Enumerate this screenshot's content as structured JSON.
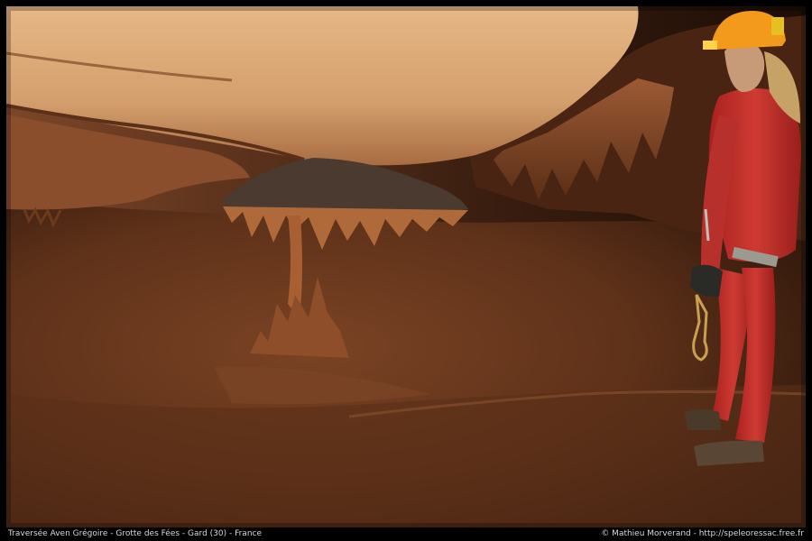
{
  "caption": {
    "left": "Traversée Aven Grégoire - Grotte des Fées - Gard (30) - France",
    "right": "© Mathieu Morverand - http://speleoressac.free.fr"
  },
  "colors": {
    "frame": "#000000",
    "caption_text": "#d8d8d8",
    "rock_ceiling": "#d9a676",
    "cave_floor": "#6b3a20",
    "mud": "#8a4a28",
    "caver_suit": "#c2302c",
    "helmet": "#f39a1c"
  },
  "scene": {
    "subjects": [
      "cave-ceiling",
      "stalactite-table",
      "stalagmite-column",
      "cave-floor",
      "caver"
    ]
  }
}
